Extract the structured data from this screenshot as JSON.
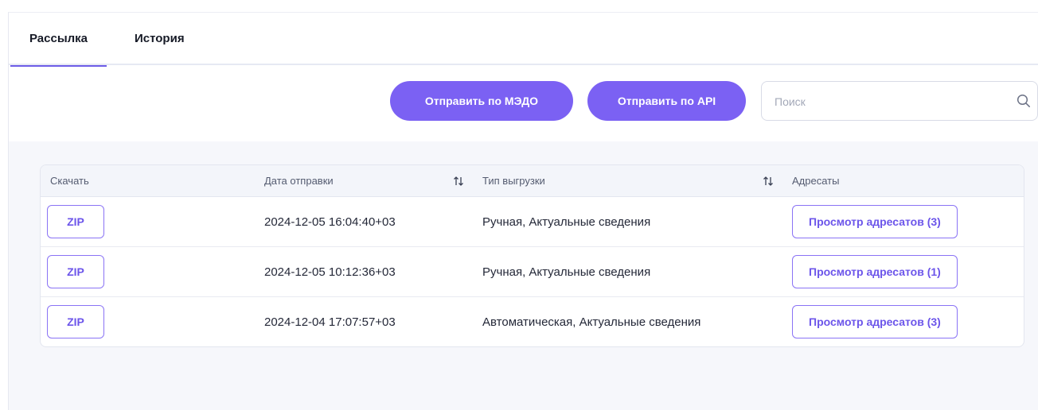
{
  "tabs": [
    {
      "label": "Рассылка",
      "active": true
    },
    {
      "label": "История",
      "active": false
    }
  ],
  "toolbar": {
    "send_medo_label": "Отправить по МЭДО",
    "send_api_label": "Отправить по API",
    "search_placeholder": "Поиск",
    "search_value": ""
  },
  "table": {
    "columns": {
      "download": "Скачать",
      "date": "Дата отправки",
      "type": "Тип выгрузки",
      "recipients": "Адресаты"
    },
    "rows": [
      {
        "download_label": "ZIP",
        "date": "2024-12-05 16:04:40+03",
        "type": "Ручная, Актуальные сведения",
        "recipients_label": "Просмотр адресатов (3)"
      },
      {
        "download_label": "ZIP",
        "date": "2024-12-05 10:12:36+03",
        "type": "Ручная, Актуальные сведения",
        "recipients_label": "Просмотр адресатов (1)"
      },
      {
        "download_label": "ZIP",
        "date": "2024-12-04 17:07:57+03",
        "type": "Автоматическая, Актуальные сведения",
        "recipients_label": "Просмотр адресатов (3)"
      }
    ]
  },
  "colors": {
    "accent": "#7b61f3",
    "accent_text": "#6c55ea",
    "panel_bg": "#f6f7fb"
  },
  "icons": {
    "search": "search-icon",
    "sort": "sort-icon"
  }
}
